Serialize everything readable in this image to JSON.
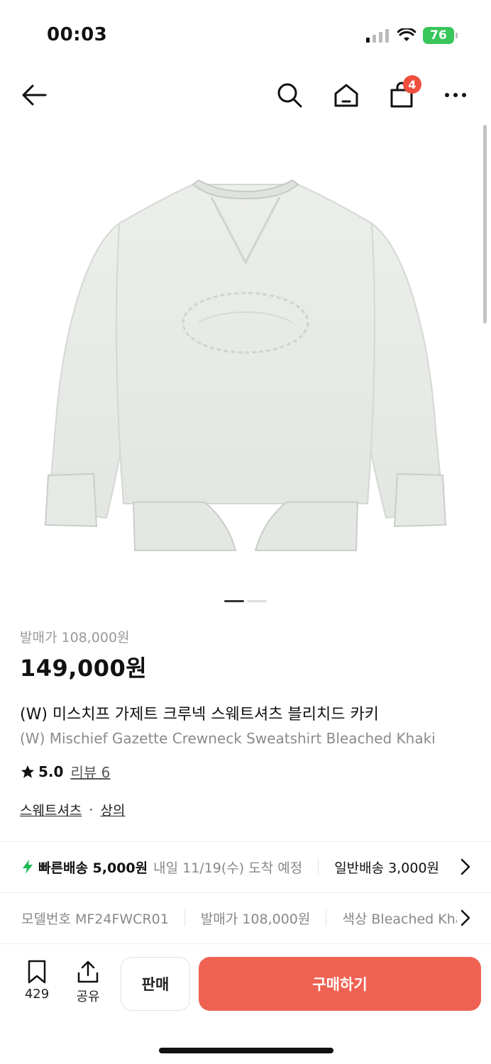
{
  "status_bar": {
    "time": "00:03",
    "battery": "76"
  },
  "nav": {
    "cart_count": "4"
  },
  "product": {
    "release_price": "발매가 108,000원",
    "price": "149,000원",
    "name_kr": "(W) 미스치프 가제트 크루넥 스웨트셔츠 블리치드 카키",
    "name_en": "(W) Mischief Gazette Crewneck Sweatshirt Bleached Khaki",
    "rating": "5.0",
    "review_label": "리뷰 6",
    "category_1": "스웨트셔츠",
    "category_sep": "·",
    "category_2": "상의"
  },
  "delivery": {
    "fast_label": "빠른배송 5,000원",
    "fast_date": "내일 11/19(수) 도착 예정",
    "standard_label": "일반배송 3,000원"
  },
  "specs": {
    "model": "모델번호 MF24FWCR01",
    "release_price": "발매가 108,000원",
    "color": "색상 Bleached Khaki"
  },
  "bottom_bar": {
    "wish_count": "429",
    "share_label": "공유",
    "sell_label": "판매",
    "buy_label": "구매하기"
  },
  "colors": {
    "accent": "#ef6253",
    "badge": "#f04e3e",
    "battery": "#38c55a",
    "fast_bolt": "#1db954"
  },
  "icons": [
    "back-arrow-icon",
    "search-icon",
    "home-icon",
    "bag-icon",
    "more-icon",
    "star-icon",
    "bolt-icon",
    "chevron-right-icon",
    "bookmark-icon",
    "share-icon"
  ],
  "image": {
    "pagination": {
      "current": 1,
      "total": 2
    }
  }
}
